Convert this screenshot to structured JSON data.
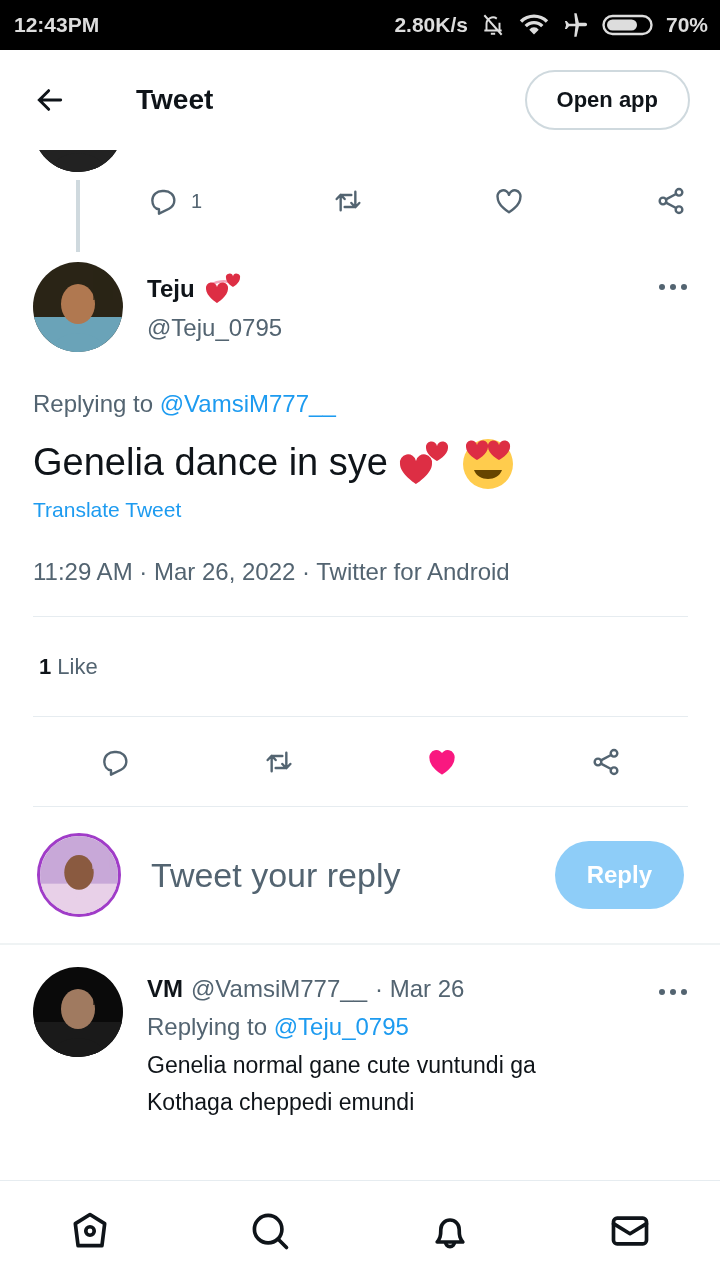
{
  "status_bar": {
    "time": "12:43PM",
    "net_speed": "2.80K/s",
    "battery": "70%"
  },
  "header": {
    "title": "Tweet",
    "button": "Open app"
  },
  "parent_tweet": {
    "reply_count": "1"
  },
  "tweet": {
    "name": "Teju",
    "handle": "@Teju_0795",
    "replying_label": "Replying to",
    "replying_to": "@VamsiM777__",
    "text": "Genelia dance in sye",
    "translate": "Translate Tweet",
    "timestamp": "11:29 AM · Mar 26, 2022 · Twitter for Android",
    "like_count": "1",
    "like_label": "Like",
    "liked": true
  },
  "reply_box": {
    "placeholder": "Tweet your reply",
    "button": "Reply",
    "disabled": true
  },
  "replies": [
    {
      "name": "VM",
      "handle": "@VamsiM777__",
      "date": "· Mar 26",
      "replying_label": "Replying to",
      "replying_to": "@Teju_0795",
      "text": "Genelia normal gane cute vuntundi ga Kothaga cheppedi emundi"
    }
  ]
}
